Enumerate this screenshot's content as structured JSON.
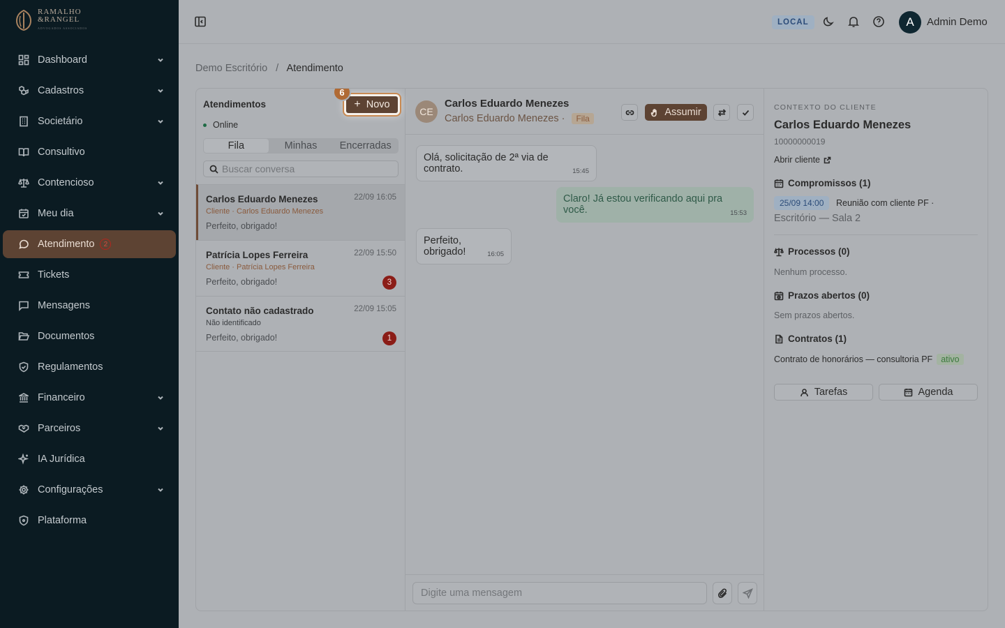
{
  "brand": {
    "line1": "RAMALHO",
    "line2": "&RANGEL",
    "line3": "ADVOGADOS ASSOCIADOS"
  },
  "sidebar": {
    "items": [
      {
        "label": "Dashboard",
        "icon": "dashboard-icon",
        "expandable": true
      },
      {
        "label": "Cadastros",
        "icon": "boxes-icon",
        "expandable": true
      },
      {
        "label": "Societário",
        "icon": "building-icon",
        "expandable": true
      },
      {
        "label": "Consultivo",
        "icon": "book-open-icon",
        "expandable": false
      },
      {
        "label": "Contencioso",
        "icon": "scale-icon",
        "expandable": true
      },
      {
        "label": "Meu dia",
        "icon": "calendar-check-icon",
        "expandable": true
      },
      {
        "label": "Atendimento",
        "icon": "message-circle-icon",
        "expandable": false,
        "active": true,
        "badge": "2"
      },
      {
        "label": "Tickets",
        "icon": "ticket-icon",
        "expandable": false
      },
      {
        "label": "Mensagens",
        "icon": "message-square-icon",
        "expandable": false
      },
      {
        "label": "Documentos",
        "icon": "folder-open-icon",
        "expandable": false
      },
      {
        "label": "Regulamentos",
        "icon": "shield-check-icon",
        "expandable": false
      },
      {
        "label": "Financeiro",
        "icon": "landmark-icon",
        "expandable": true
      },
      {
        "label": "Parceiros",
        "icon": "handshake-icon",
        "expandable": true
      },
      {
        "label": "IA Jurídica",
        "icon": "sparkles-icon",
        "expandable": false
      },
      {
        "label": "Configurações",
        "icon": "settings-icon",
        "expandable": true
      },
      {
        "label": "Plataforma",
        "icon": "shield-icon",
        "expandable": false
      }
    ]
  },
  "topbar": {
    "env_badge": "LOCAL",
    "avatar_initial": "A",
    "user_name": "Admin Demo"
  },
  "breadcrumb": {
    "root": "Demo Escritório",
    "separator": "/",
    "current": "Atendimento"
  },
  "list": {
    "title": "Atendimentos",
    "status": "Online",
    "new_button": "Novo",
    "step_badge": "6",
    "tabs": [
      "Fila",
      "Minhas",
      "Encerradas"
    ],
    "active_tab": "Fila",
    "search_placeholder": "Buscar conversa",
    "conversations": [
      {
        "name": "Carlos Eduardo Menezes",
        "time": "22/09 16:05",
        "sub": "Cliente · Carlos Eduardo Menezes",
        "last": "Perfeito, obrigado!",
        "unread": "",
        "selected": true
      },
      {
        "name": "Patrícia Lopes Ferreira",
        "time": "22/09 15:50",
        "sub": "Cliente · Patrícia Lopes Ferreira",
        "last": "Perfeito, obrigado!",
        "unread": "3",
        "selected": false
      },
      {
        "name": "Contato não cadastrado",
        "time": "22/09 15:05",
        "sub": "Não identificado",
        "last": "Perfeito, obrigado!",
        "unread": "1",
        "selected": false
      }
    ]
  },
  "chat": {
    "avatar_initials": "CE",
    "name": "Carlos Eduardo Menezes",
    "subtitle": "Carlos Eduardo Menezes",
    "queue_badge": "Fila",
    "assume_button": "Assumir",
    "messages": [
      {
        "direction": "in",
        "text": "Olá, solicitação de 2ª via de contrato.",
        "time": "15:45"
      },
      {
        "direction": "out",
        "text": "Claro! Já estou verificando aqui pra você.",
        "time": "15:53"
      },
      {
        "direction": "in",
        "text": "Perfeito, obrigado!",
        "time": "16:05"
      }
    ],
    "input_placeholder": "Digite uma mensagem"
  },
  "context": {
    "label": "CONTEXTO DO CLIENTE",
    "client_name": "Carlos Eduardo Menezes",
    "client_id": "10000000019",
    "open_client": "Abrir cliente",
    "commitments_title": "Compromissos (1)",
    "commitment": {
      "date": "25/09 14:00",
      "title": "Reunião com cliente PF ·",
      "location": "Escritório — Sala 2"
    },
    "processes_title": "Processos (0)",
    "processes_empty": "Nenhum processo.",
    "deadlines_title": "Prazos abertos (0)",
    "deadlines_empty": "Sem prazos abertos.",
    "contracts_title": "Contratos (1)",
    "contract": {
      "name": "Contrato de honorários — consultoria PF",
      "status": "ativo"
    },
    "buttons": {
      "tasks": "Tarefas",
      "agenda": "Agenda"
    }
  }
}
